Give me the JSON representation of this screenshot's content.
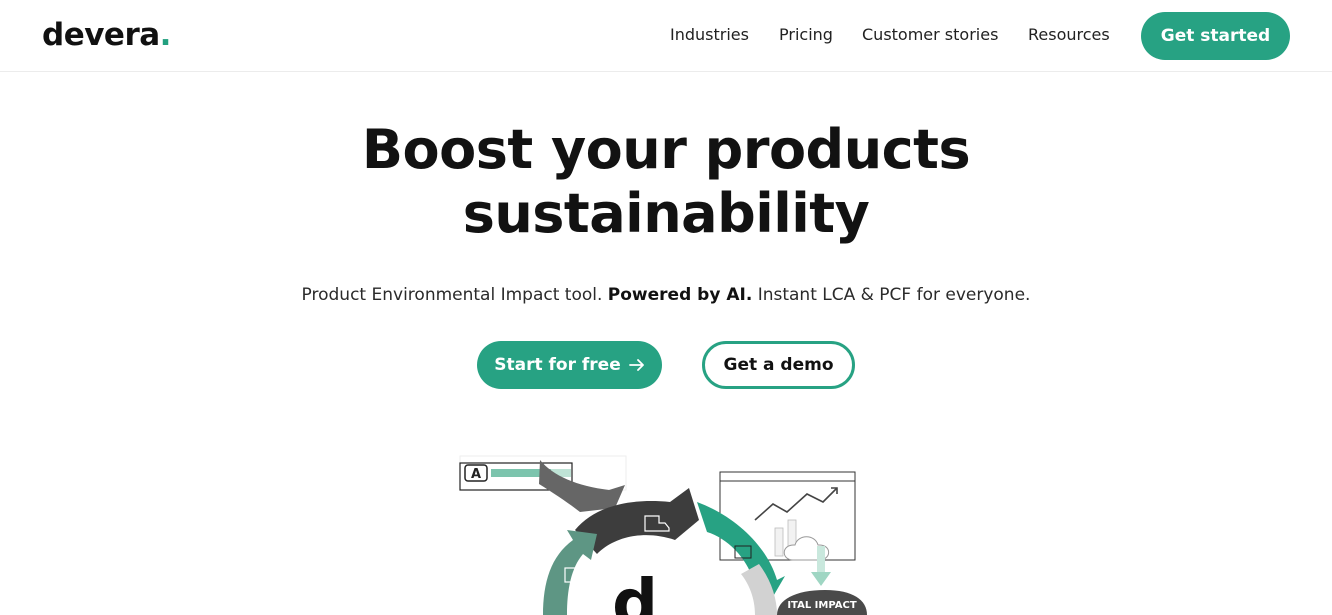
{
  "header": {
    "logo_text": "devera",
    "logo_dot": ".",
    "nav": [
      "Industries",
      "Pricing",
      "Customer stories",
      "Resources"
    ],
    "cta_label": "Get started"
  },
  "hero": {
    "title_line1": "Boost your products",
    "title_line2": "sustainability",
    "subtitle_pre": "Product Environmental Impact tool.",
    "subtitle_bold": "Powered by AI.",
    "subtitle_post": "Instant LCA & PCF for everyone.",
    "primary_cta": "Start for free",
    "primary_cta_icon": "arrow-right-icon",
    "secondary_cta": "Get a demo"
  },
  "illustration": {
    "badge_letter": "A",
    "center_letter": "d",
    "ring_text": "ITAL IMPACT"
  },
  "colors": {
    "accent": "#27a283",
    "dark_arrow": "#3d3d3d",
    "gray_arrow": "#666666",
    "sage_arrow": "#5e9684"
  }
}
